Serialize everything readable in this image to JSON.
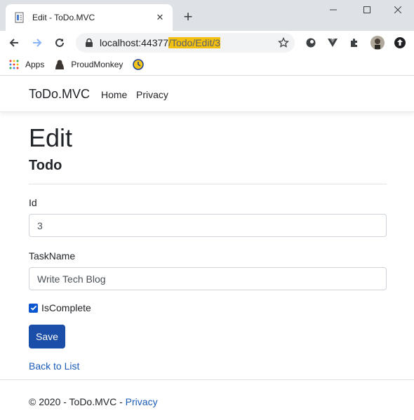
{
  "browser": {
    "tab_title": "Edit - ToDo.MVC",
    "tab_close": "✕",
    "new_tab": "+",
    "url_host": "localhost:44377",
    "url_path": "/Todo/Edit/3",
    "bookmarks": [
      {
        "label": "Apps",
        "icon": "apps-grid-icon"
      },
      {
        "label": "ProudMonkey",
        "icon": "monkey-icon"
      },
      {
        "label": "",
        "icon": "clock-bookmark-icon"
      }
    ],
    "accent_color": "#f3c00f"
  },
  "site": {
    "brand": "ToDo.MVC",
    "nav": [
      "Home",
      "Privacy"
    ]
  },
  "page": {
    "title": "Edit",
    "subtitle": "Todo",
    "fields": {
      "id_label": "Id",
      "id_value": "3",
      "taskname_label": "TaskName",
      "taskname_value": "Write Tech Blog",
      "iscomplete_label": "IsComplete",
      "iscomplete_checked": true
    },
    "save_label": "Save",
    "back_link": "Back to List",
    "primary_color": "#1b4ea8"
  },
  "footer": {
    "text": "© 2020 - ToDo.MVC - ",
    "link": "Privacy"
  }
}
